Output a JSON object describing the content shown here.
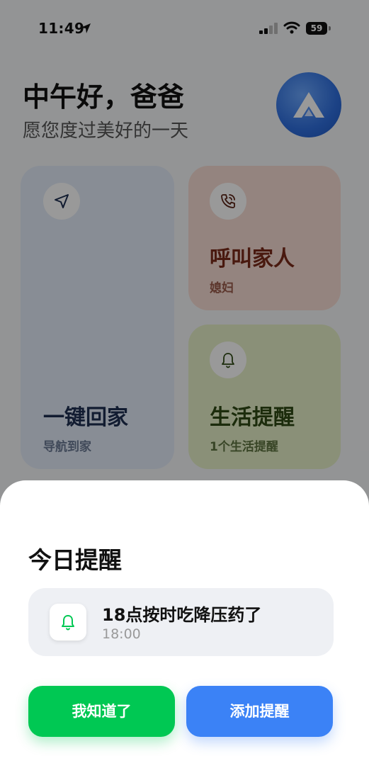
{
  "status_bar": {
    "time": "11:49",
    "battery": "59"
  },
  "header": {
    "greeting": "中午好，爸爸",
    "subtitle": "愿您度过美好的一天"
  },
  "tiles": {
    "home": {
      "title": "一键回家",
      "subtitle": "导航到家",
      "icon": "navigation-arrow-icon",
      "color": "#e3ecf8"
    },
    "call": {
      "title": "呼叫家人",
      "subtitle": "媳妇",
      "icon": "phone-call-icon",
      "color": "#f7ddd4"
    },
    "remind": {
      "title": "生活提醒",
      "subtitle": "1个生活提醒",
      "icon": "bell-icon",
      "color": "#e6f0c8"
    }
  },
  "sheet": {
    "title": "今日提醒",
    "reminder": {
      "title": "18点按时吃降压药了",
      "time": "18:00",
      "icon": "bell-icon"
    },
    "buttons": {
      "ok": "我知道了",
      "add": "添加提醒"
    }
  },
  "colors": {
    "green": "#00c853",
    "blue": "#3b82f6",
    "avatar": "#2f6fdf"
  }
}
